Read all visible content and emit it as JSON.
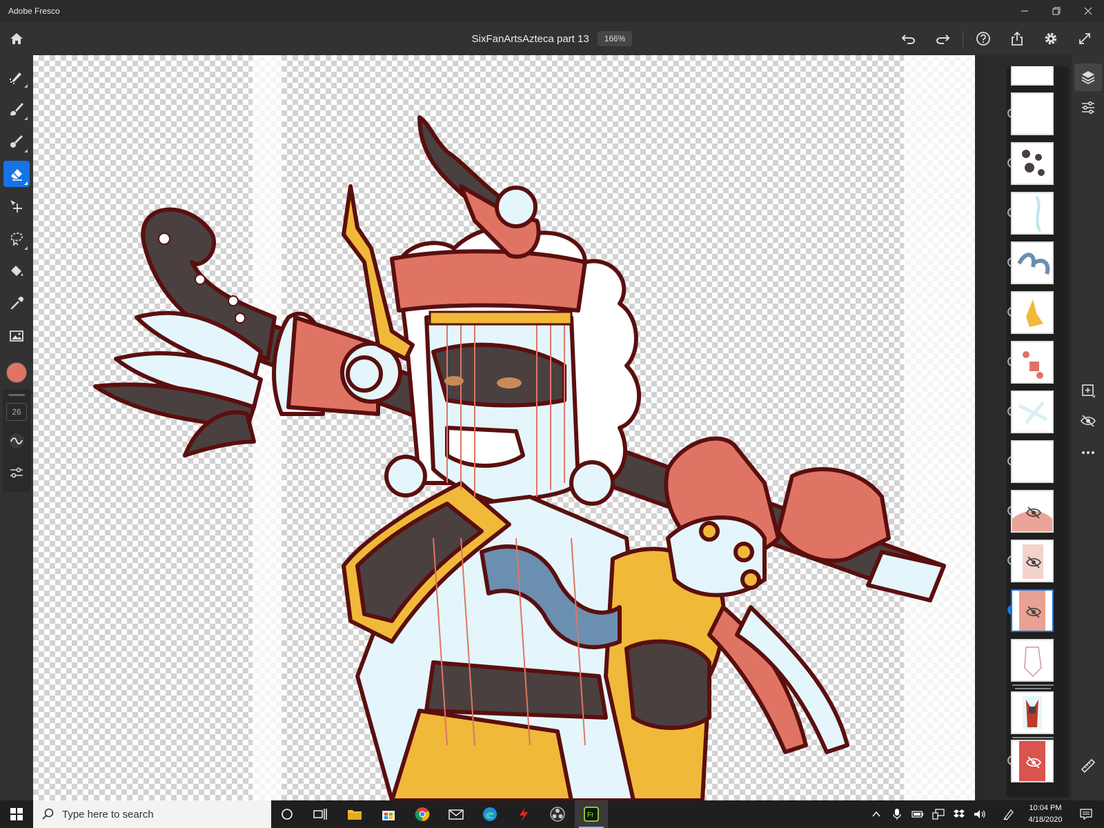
{
  "window": {
    "app_name": "Adobe Fresco"
  },
  "topbar": {
    "document_title": "SixFanArtsAzteca part 13",
    "zoom": "166%"
  },
  "tools": {
    "brush_size": "26",
    "active_tool": "eraser",
    "current_color": "#e07464"
  },
  "layers": {
    "count_visible_rows": 15,
    "selected_index": 11,
    "hidden_indices": [
      9,
      10,
      11,
      14
    ]
  },
  "taskbar": {
    "search_placeholder": "Type here to search",
    "time": "10:04 PM",
    "date": "4/18/2020"
  },
  "colors": {
    "accent": "#1473e6",
    "brush": "#e07464",
    "art_outline": "#5a0f0f",
    "art_dark": "#4a4040",
    "art_pale": "#e4f6fb",
    "art_gold": "#f0b93a"
  }
}
